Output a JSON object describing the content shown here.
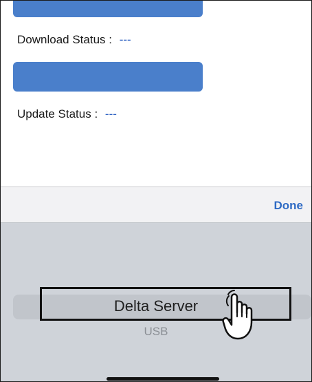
{
  "form": {
    "download_status_label": "Download Status :",
    "download_status_value": "---",
    "update_status_label": "Update Status :",
    "update_status_value": "---"
  },
  "toolbar": {
    "done_label": "Done"
  },
  "picker": {
    "options": [
      {
        "label": "Delta Server",
        "selected": true
      },
      {
        "label": "USB",
        "selected": false
      }
    ]
  },
  "icons": {
    "pointer": "hand-pointer-icon"
  },
  "colors": {
    "button_blue": "#4a7fcb",
    "status_value": "#2f62c2",
    "done_blue": "#2f6bc4",
    "picker_bg": "#cfd3d9"
  }
}
